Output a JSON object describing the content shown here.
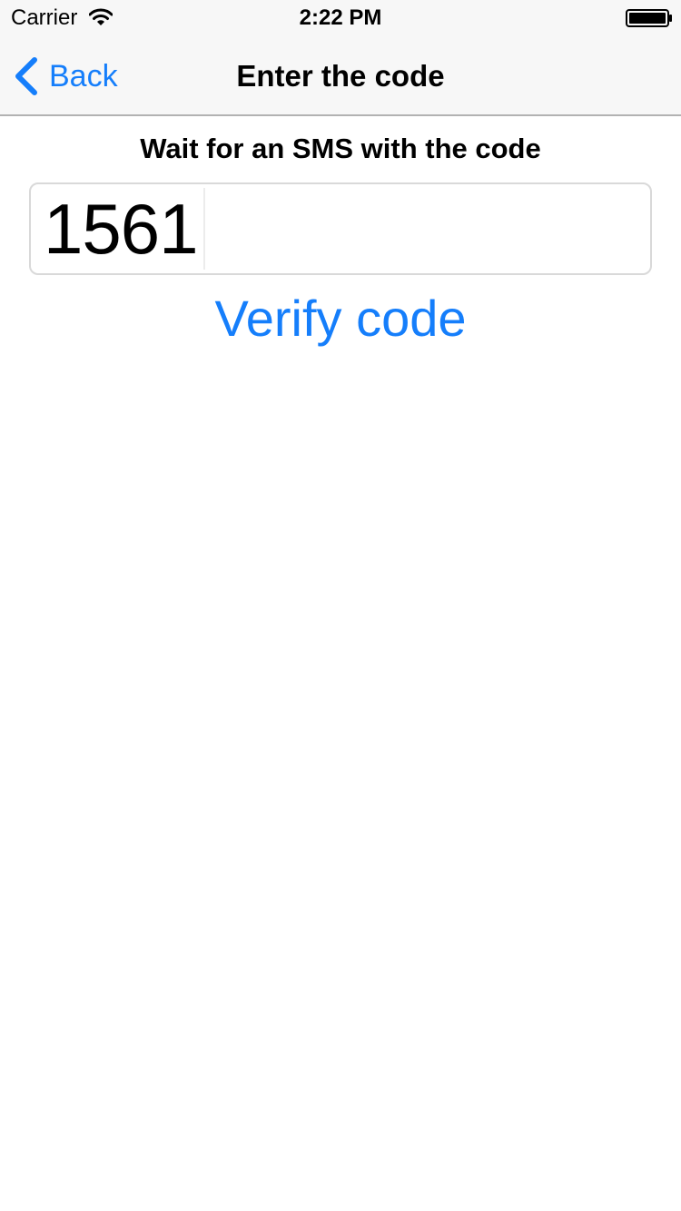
{
  "status_bar": {
    "carrier": "Carrier",
    "time": "2:22 PM",
    "icons": [
      "wifi-icon",
      "battery-icon"
    ]
  },
  "nav_bar": {
    "back_label": "Back",
    "back_icon": "chevron-left-icon",
    "title": "Enter the code"
  },
  "content": {
    "instruction": "Wait for an SMS with the code",
    "code_value": "1561",
    "verify_label": "Verify code"
  },
  "colors": {
    "accent": "#157efb",
    "bar_background": "#f7f7f7",
    "bar_border": "#b2b2b2",
    "field_border": "#d9d9d9",
    "text": "#000000"
  }
}
